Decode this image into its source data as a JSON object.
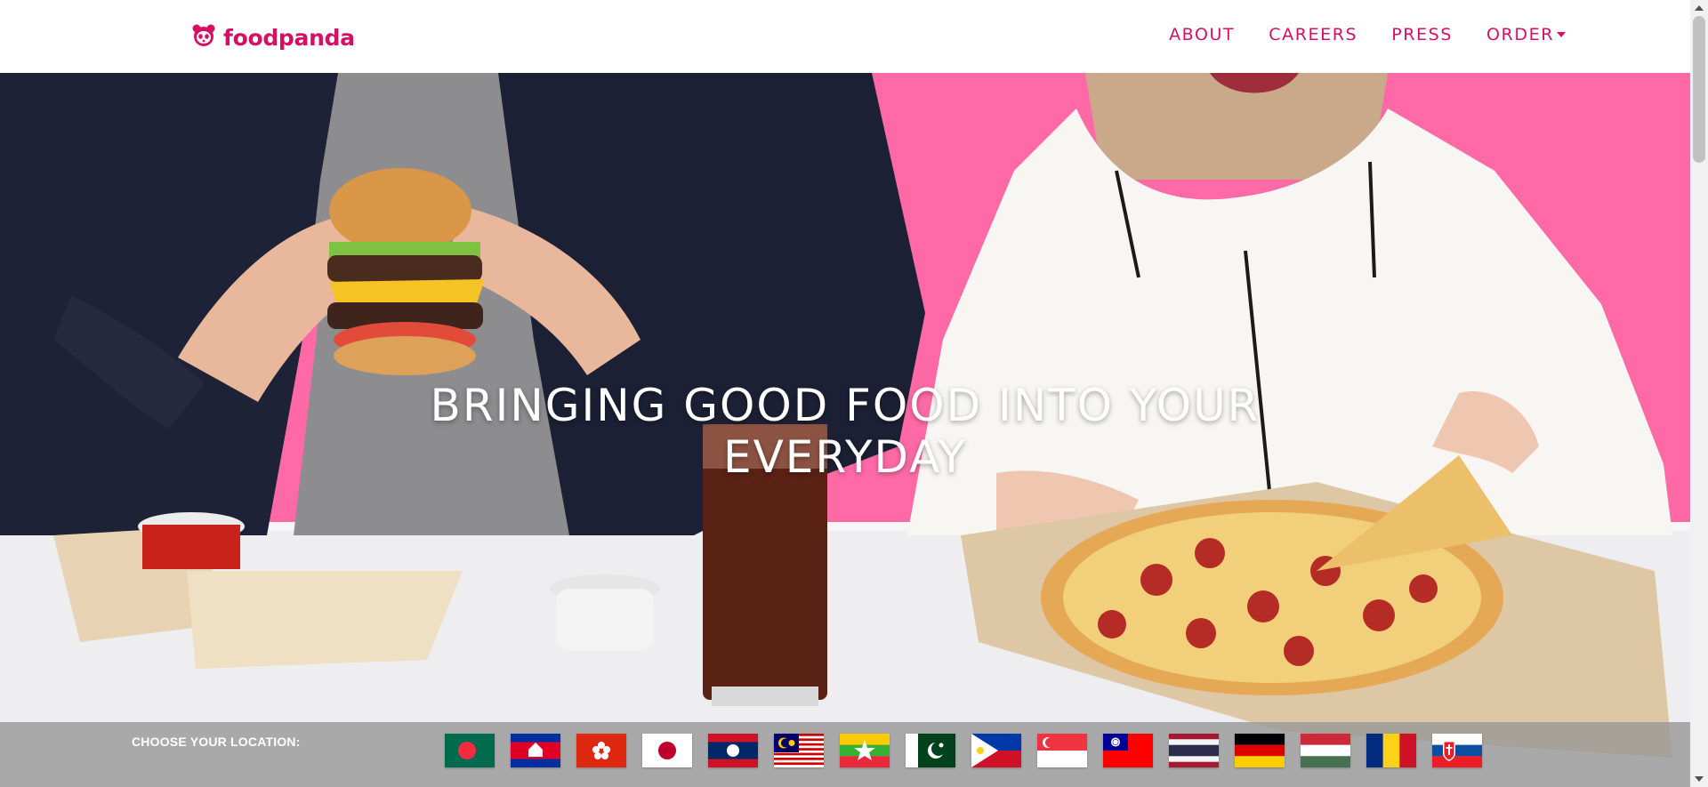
{
  "brand": {
    "name": "foodpanda",
    "color": "#d70f64",
    "logo_icon": "panda-icon"
  },
  "nav": {
    "items": [
      {
        "label": "ABOUT"
      },
      {
        "label": "CAREERS"
      },
      {
        "label": "PRESS"
      },
      {
        "label": "ORDER",
        "has_dropdown": true
      }
    ]
  },
  "hero": {
    "headline_line1": "BRINGING GOOD FOOD INTO YOUR",
    "headline_line2": "EVERYDAY",
    "background_color": "#ff6aa6"
  },
  "location": {
    "label": "CHOOSE YOUR LOCATION:",
    "flags": [
      {
        "country": "bangladesh",
        "icon": "bangladesh-flag-icon"
      },
      {
        "country": "cambodia",
        "icon": "cambodia-flag-icon"
      },
      {
        "country": "hong-kong",
        "icon": "hong-kong-flag-icon"
      },
      {
        "country": "japan",
        "icon": "japan-flag-icon"
      },
      {
        "country": "laos",
        "icon": "laos-flag-icon"
      },
      {
        "country": "malaysia",
        "icon": "malaysia-flag-icon"
      },
      {
        "country": "myanmar",
        "icon": "myanmar-flag-icon"
      },
      {
        "country": "pakistan",
        "icon": "pakistan-flag-icon"
      },
      {
        "country": "philippines",
        "icon": "philippines-flag-icon"
      },
      {
        "country": "singapore",
        "icon": "singapore-flag-icon"
      },
      {
        "country": "taiwan",
        "icon": "taiwan-flag-icon"
      },
      {
        "country": "thailand",
        "icon": "thailand-flag-icon"
      },
      {
        "country": "germany",
        "icon": "germany-flag-icon"
      },
      {
        "country": "hungary",
        "icon": "hungary-flag-icon"
      },
      {
        "country": "romania",
        "icon": "romania-flag-icon"
      },
      {
        "country": "slovakia",
        "icon": "slovakia-flag-icon"
      }
    ]
  }
}
